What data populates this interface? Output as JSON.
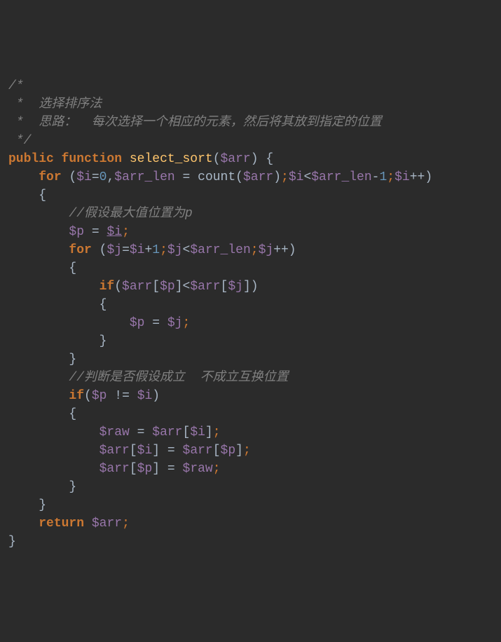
{
  "code": {
    "c1": "/*",
    "c2": " *  选择排序法",
    "c3": " *  思路：  每次选择一个相应的元素，然后将其放到指定的位置",
    "c4": " */",
    "kw_public": "public",
    "kw_function": "function",
    "fn_name": "select_sort",
    "v_arr": "$arr",
    "kw_for": "for",
    "v_i": "$i",
    "n0": "0",
    "v_arr_len": "$arr_len",
    "fn_count": "count",
    "n1": "1",
    "c5": "//假设最大值位置为p",
    "v_p": "$p",
    "v_j": "$j",
    "kw_if": "if",
    "c6": "//判断是否假设成立  不成立互换位置",
    "v_raw": "$raw",
    "kw_return": "return",
    "lp": "(",
    "rp": ")",
    "lb": "{",
    "rb": "}",
    "ls": "[",
    "rs": "]",
    "eq": "=",
    "lt": "<",
    "ne": "!=",
    "comma": ",",
    "minus": "-",
    "plus": "+",
    "pp": "++",
    "sc": ";"
  }
}
